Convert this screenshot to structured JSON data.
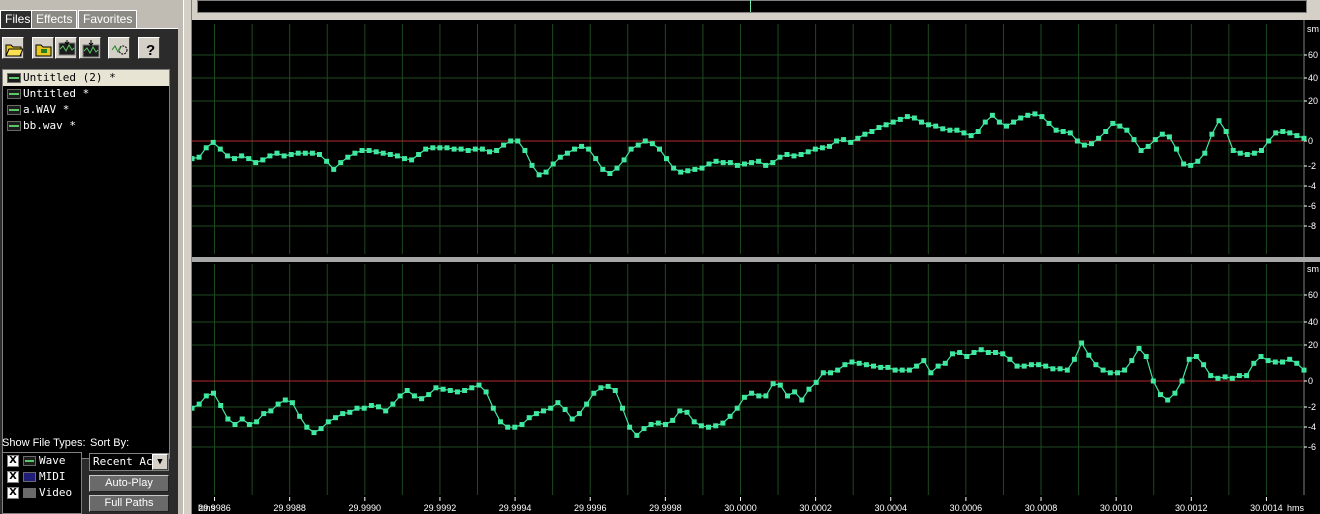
{
  "organizer": {
    "tabs": [
      "Files",
      "Effects",
      "Favorites"
    ],
    "active_tab": "Files",
    "toolbar": [
      {
        "name": "open-file",
        "icon": "folder-open-icon"
      },
      {
        "name": "import-file",
        "icon": "folder-import-icon"
      },
      {
        "name": "close-file",
        "icon": "close-file-icon"
      },
      {
        "name": "insert-into-multitrack",
        "icon": "insert-multitrack-icon"
      },
      {
        "name": "edit-file",
        "icon": "edit-wave-icon"
      },
      {
        "name": "help",
        "icon": "help-question-icon"
      }
    ],
    "files": [
      {
        "label": "Untitled (2) *",
        "selected": true
      },
      {
        "label": "Untitled *",
        "selected": false
      },
      {
        "label": "a.WAV *",
        "selected": false
      },
      {
        "label": "bb.wav *",
        "selected": false
      }
    ],
    "show_file_types_label": "Show File Types:",
    "sort_by_label": "Sort By:",
    "file_types": [
      {
        "label": "Wave",
        "checked": true,
        "check_mark": "X"
      },
      {
        "label": "MIDI",
        "checked": true,
        "check_mark": "X"
      },
      {
        "label": "Video",
        "checked": true,
        "check_mark": "X"
      }
    ],
    "sort_value": "Recent Acc",
    "autoplay_label": "Auto-Play",
    "fullpaths_label": "Full Paths"
  },
  "colors": {
    "waveform": "#40e8a0",
    "grid": "#1e4a1e",
    "zero_line": "#b42828",
    "background": "#000000"
  },
  "axis": {
    "time_unit": "hms",
    "time_ticks": [
      "29.9986",
      "29.9988",
      "29.9990",
      "29.9992",
      "29.9994",
      "29.9996",
      "29.9998",
      "30.0000",
      "30.0002",
      "30.0004",
      "30.0006",
      "30.0008",
      "30.0010",
      "30.0012",
      "30.0014"
    ],
    "amp_unit": "sm",
    "top_channel_ticks": [
      "60",
      "40",
      "20",
      "0",
      "-2",
      "-4",
      "-6",
      "-8"
    ],
    "bottom_channel_ticks": [
      "60",
      "40",
      "20",
      "0",
      "-2",
      "-4",
      "-6"
    ]
  },
  "chart_data": {
    "type": "line",
    "x_range": [
      29.99854,
      30.0015
    ],
    "y_range": [
      -85,
      85
    ],
    "series": [
      {
        "channel": "top",
        "values": [
          -13,
          -12,
          -5,
          -1,
          -6,
          -11,
          -13,
          -11,
          -13,
          -16,
          -14,
          -11,
          -9,
          -11,
          -10,
          -9,
          -9,
          -9,
          -10,
          -15,
          -21,
          -16,
          -12,
          -9,
          -7,
          -7,
          -8,
          -9,
          -10,
          -11,
          -13,
          -14,
          -10,
          -6,
          -5,
          -5,
          -5,
          -6,
          -6,
          -7,
          -6,
          -6,
          -8,
          -7,
          -3,
          0,
          0,
          -7,
          -18,
          -25,
          -23,
          -17,
          -12,
          -9,
          -6,
          -4,
          -6,
          -13,
          -21,
          -24,
          -20,
          -14,
          -6,
          -3,
          0,
          -2,
          -6,
          -13,
          -20,
          -23,
          -22,
          -21,
          -20,
          -17,
          -15,
          -16,
          -16,
          -18,
          -17,
          -16,
          -15,
          -18,
          -16,
          -12,
          -10,
          -11,
          -10,
          -8,
          -6,
          -5,
          -4,
          0,
          1,
          -1,
          2,
          5,
          7,
          10,
          12,
          14,
          16,
          18,
          17,
          14,
          12,
          11,
          9,
          8,
          8,
          6,
          4,
          7,
          14,
          19,
          14,
          11,
          14,
          17,
          19,
          20,
          18,
          13,
          8,
          7,
          6,
          0,
          -3,
          -2,
          2,
          7,
          13,
          11,
          8,
          1,
          -7,
          -4,
          1,
          5,
          3,
          -6,
          -17,
          -18,
          -15,
          -9,
          5,
          15,
          7,
          -7,
          -9,
          -10,
          -9,
          -7,
          0,
          6,
          7,
          6,
          4,
          2
        ]
      },
      {
        "channel": "bottom",
        "values": [
          -20,
          -17,
          -11,
          -9,
          -18,
          -28,
          -32,
          -28,
          -32,
          -30,
          -24,
          -22,
          -17,
          -14,
          -16,
          -26,
          -34,
          -38,
          -35,
          -30,
          -27,
          -24,
          -23,
          -20,
          -20,
          -18,
          -19,
          -22,
          -17,
          -11,
          -7,
          -11,
          -13,
          -10,
          -5,
          -6,
          -7,
          -8,
          -7,
          -5,
          -3,
          -8,
          -20,
          -30,
          -34,
          -34,
          -32,
          -27,
          -24,
          -22,
          -20,
          -16,
          -21,
          -28,
          -24,
          -17,
          -9,
          -5,
          -4,
          -7,
          -20,
          -34,
          -40,
          -35,
          -32,
          -31,
          -32,
          -29,
          -22,
          -23,
          -30,
          -33,
          -34,
          -33,
          -31,
          -26,
          -20,
          -12,
          -9,
          -11,
          -11,
          -2,
          -3,
          -11,
          -8,
          -14,
          -6,
          -1,
          6,
          6,
          8,
          12,
          14,
          13,
          12,
          11,
          10,
          10,
          8,
          8,
          8,
          11,
          15,
          6,
          11,
          13,
          20,
          21,
          18,
          21,
          23,
          21,
          21,
          20,
          16,
          11,
          11,
          12,
          12,
          11,
          9,
          9,
          8,
          16,
          28,
          19,
          12,
          8,
          6,
          6,
          8,
          15,
          24,
          18,
          0,
          -10,
          -14,
          -9,
          0,
          16,
          18,
          12,
          4,
          2,
          3,
          2,
          4,
          4,
          13,
          18,
          15,
          14,
          14,
          16,
          13,
          8
        ]
      }
    ]
  }
}
